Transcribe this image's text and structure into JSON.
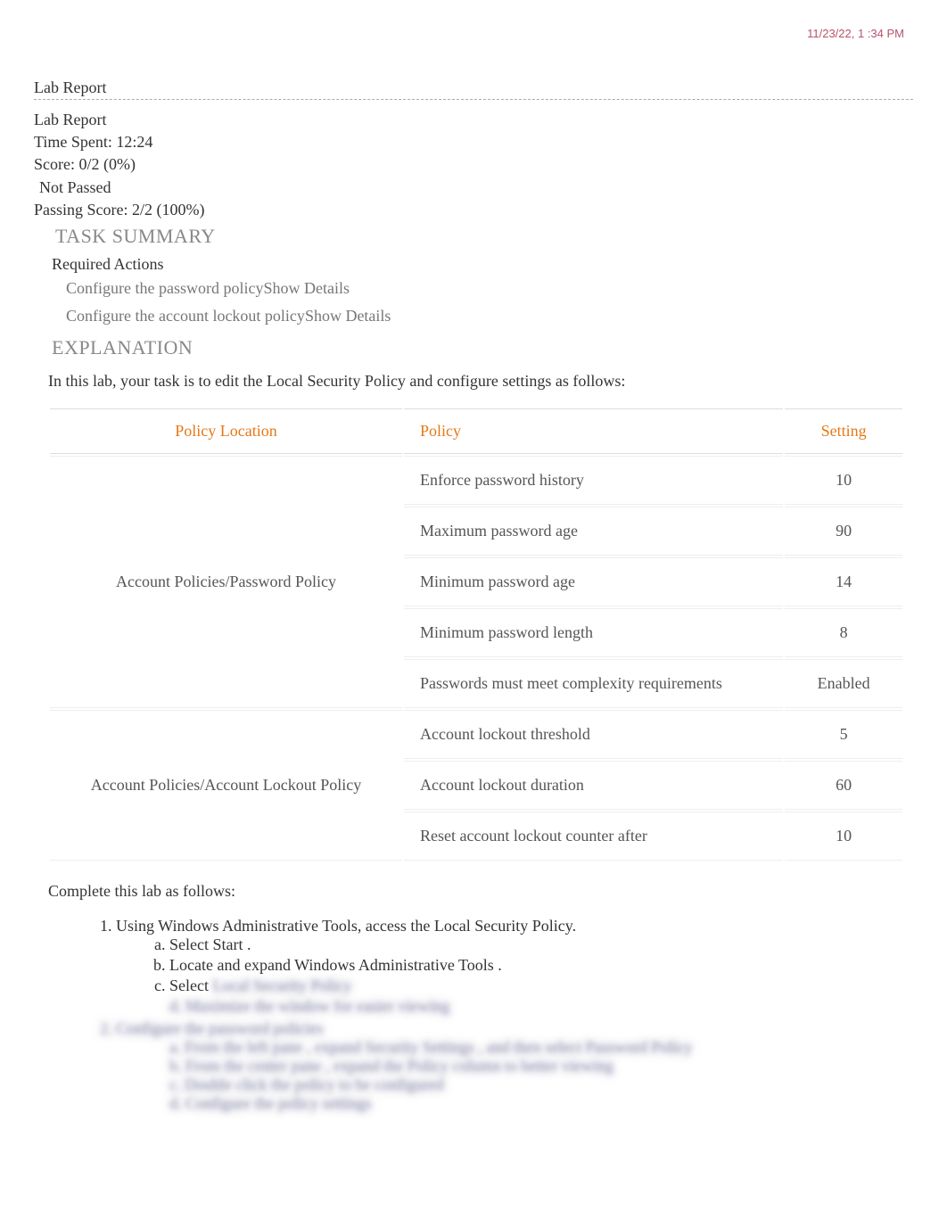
{
  "timestamp": "11/23/22, 1 :34 PM",
  "page_title": "Lab Report",
  "meta": {
    "title": "Lab Report",
    "time_spent_label": "Time Spent: 12:24",
    "score_label": "Score: 0/2 (0%)",
    "status": "Not Passed",
    "passing_label": "Passing Score: 2/2 (100%)"
  },
  "task_summary_heading": "TASK SUMMARY",
  "required_actions_heading": "Required Actions",
  "actions": [
    {
      "text": "Configure the password policy",
      "details": "Show Details"
    },
    {
      "text": "Configure the account lockout policy",
      "details": "Show Details"
    }
  ],
  "explanation_heading": "EXPLANATION",
  "intro": "In this lab, your task is to edit the Local Security Policy and configure settings as follows:",
  "table": {
    "headers": {
      "location": "Policy Location",
      "policy": "Policy",
      "setting": "Setting"
    },
    "groups": [
      {
        "location": "Account Policies/Password Policy",
        "rows": [
          {
            "policy": "Enforce password history",
            "setting": "10"
          },
          {
            "policy": "Maximum password age",
            "setting": "90"
          },
          {
            "policy": "Minimum password age",
            "setting": "14"
          },
          {
            "policy": "Minimum password length",
            "setting": "8"
          },
          {
            "policy": "Passwords must meet complexity requirements",
            "setting": "Enabled"
          }
        ]
      },
      {
        "location": "Account Policies/Account Lockout Policy",
        "rows": [
          {
            "policy": "Account lockout threshold",
            "setting": "5"
          },
          {
            "policy": "Account lockout duration",
            "setting": "60"
          },
          {
            "policy": "Reset account lockout counter after",
            "setting": "10"
          }
        ]
      }
    ]
  },
  "complete_label": "Complete this lab as follows:",
  "steps": {
    "s1": "Using Windows Administrative Tools, access the Local Security Policy.",
    "s1a": "Select Start .",
    "s1b_pre": "Locate ",
    "s1b_mid": "and ",
    "s1b_post": "expand Windows Administrative Tools    .",
    "s1c": "Select ",
    "blur_c": "Local Security Policy",
    "blur_d": "d. Maximize the window for easier viewing",
    "blur_2": "2. Configure the password policies",
    "blur_2a": "a. From the left pane , expand Security Settings , and then select Password Policy",
    "blur_2b": "b. From the center pane , expand the Policy column to better viewing",
    "blur_2c": "c. Double click the policy to be configured",
    "blur_2d": "d. Configure the policy settings"
  }
}
